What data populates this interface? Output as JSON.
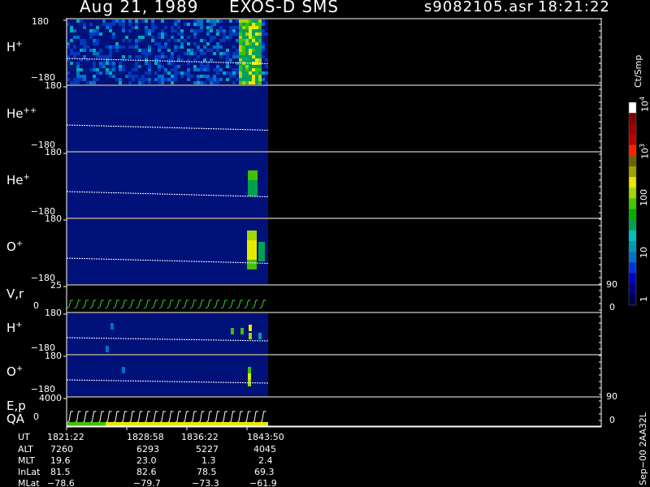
{
  "header": {
    "date": "Aug 21, 1989",
    "instrument": "EXOS-D SMS",
    "file": "s9082105.asr",
    "time": "18:21:22"
  },
  "colorbar": {
    "label": "Ct/Smp",
    "ticks": [
      "1",
      "10",
      "100",
      "10",
      "10"
    ],
    "tick_powers": [
      "",
      "",
      "",
      "3",
      "4"
    ],
    "colors": [
      "#00004a",
      "#00008a",
      "#0000c8",
      "#0030e0",
      "#0070c8",
      "#0098b4",
      "#00c0c0",
      "#00a050",
      "#00b000",
      "#40c800",
      "#a0d800",
      "#e8e800",
      "#a0a000",
      "#706000",
      "#ff2000",
      "#c00000",
      "#a00000",
      "#800000",
      "#ffffff"
    ]
  },
  "panels": {
    "h_plus": {
      "label": "H",
      "sup": "+",
      "ymax": "180",
      "ymin": "−180"
    },
    "he_pp": {
      "label": "He",
      "sup": "++",
      "ymax": "180",
      "ymin": "−180"
    },
    "he_plus": {
      "label": "He",
      "sup": "+",
      "ymax": "180",
      "ymin": "−180"
    },
    "o_plus": {
      "label": "O",
      "sup": "+",
      "ymax": "180",
      "ymin": "−180"
    },
    "vr": {
      "label": "V,r",
      "ymax": "25",
      "ymin": "0",
      "right_max": "90",
      "right_min": "0"
    },
    "h_plus2": {
      "label": "H",
      "sup": "+",
      "ymax": "180",
      "ymin": "−180"
    },
    "o_plus2": {
      "label": "O",
      "sup": "+",
      "ymax": "180",
      "ymin": "−180"
    },
    "ep": {
      "label": "E,p",
      "ymax": "4000",
      "ymin": "0",
      "right_max": "90",
      "right_min": "0"
    },
    "qa": {
      "label": "QA"
    }
  },
  "ephemeris": {
    "rows": [
      {
        "name": "UT",
        "values": [
          "1821:22",
          "1828:58",
          "1836:22",
          "1843:50"
        ]
      },
      {
        "name": "ALT",
        "values": [
          "7260",
          "6293",
          "5227",
          "4045"
        ]
      },
      {
        "name": "MLT",
        "values": [
          "19.6",
          "23.0",
          "1.3",
          "2.4"
        ]
      },
      {
        "name": "InLat",
        "values": [
          "81.5",
          "82.6",
          "78.5",
          "69.3"
        ]
      },
      {
        "name": "MLat",
        "values": [
          "−78.6",
          "−79.7",
          "−73.3",
          "−61.9"
        ]
      }
    ]
  },
  "footer": {
    "vertical": "Sep−00  2AA32L"
  },
  "chart_data": {
    "type": "heatmap",
    "title": "Aug 21, 1989   EXOS-D SMS",
    "x_ticks": [
      "1821:22",
      "1828:58",
      "1836:22",
      "1843:50"
    ],
    "panels": [
      {
        "name": "H+",
        "ylim": [
          -180,
          180
        ]
      },
      {
        "name": "He++",
        "ylim": [
          -180,
          180
        ]
      },
      {
        "name": "He+",
        "ylim": [
          -180,
          180
        ]
      },
      {
        "name": "O+",
        "ylim": [
          -180,
          180
        ]
      },
      {
        "name": "V,r",
        "ylim": [
          0,
          25
        ]
      },
      {
        "name": "H+",
        "ylim": [
          -180,
          180
        ]
      },
      {
        "name": "O+",
        "ylim": [
          -180,
          180
        ]
      },
      {
        "name": "E,p",
        "ylim": [
          0,
          4000
        ]
      }
    ],
    "color_scale": {
      "label": "Ct/Smp",
      "log": true,
      "range": [
        1,
        10000
      ]
    }
  }
}
